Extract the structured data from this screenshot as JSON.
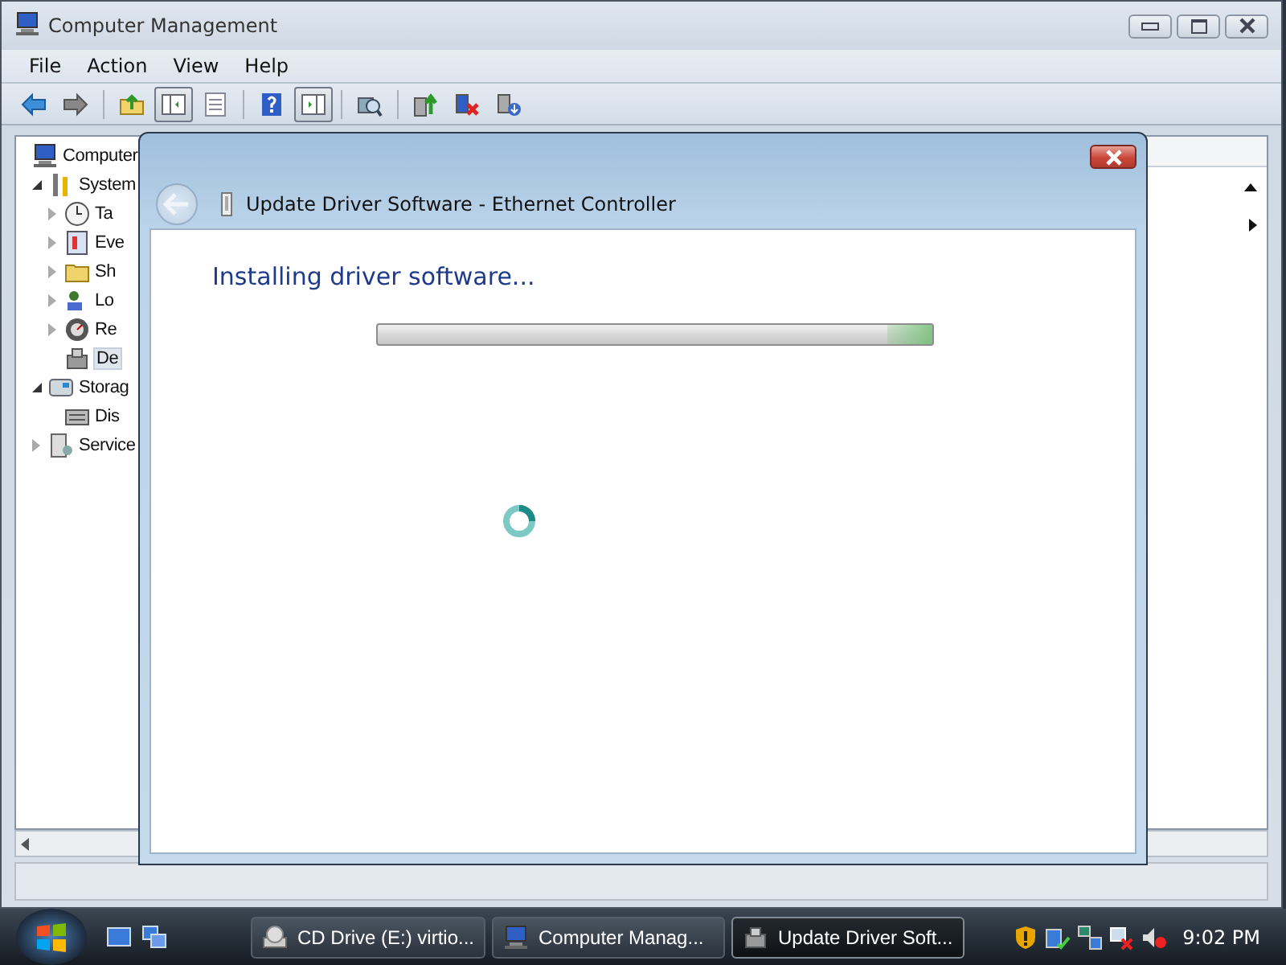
{
  "window": {
    "title": "Computer Management"
  },
  "menu": [
    "File",
    "Action",
    "View",
    "Help"
  ],
  "toolbar": [
    {
      "kind": "back",
      "pressed": false
    },
    {
      "kind": "forward",
      "pressed": false
    },
    {
      "kind": "sep"
    },
    {
      "kind": "up",
      "pressed": false
    },
    {
      "kind": "tree",
      "pressed": true
    },
    {
      "kind": "list",
      "pressed": false
    },
    {
      "kind": "sep"
    },
    {
      "kind": "help",
      "pressed": false
    },
    {
      "kind": "pane",
      "pressed": true
    },
    {
      "kind": "sep"
    },
    {
      "kind": "scan",
      "pressed": false
    },
    {
      "kind": "sep"
    },
    {
      "kind": "update",
      "pressed": false
    },
    {
      "kind": "uninstall",
      "pressed": false
    },
    {
      "kind": "disable",
      "pressed": false
    }
  ],
  "tree": [
    {
      "label": "Computer",
      "children": [
        {
          "label": "System",
          "expanded": true,
          "children": [
            {
              "label": "Ta",
              "expanded": false
            },
            {
              "label": "Eve",
              "expanded": false
            },
            {
              "label": "Sh",
              "expanded": false
            },
            {
              "label": "Lo",
              "expanded": false
            },
            {
              "label": "Re",
              "expanded": false
            },
            {
              "label": "De",
              "selected": true
            }
          ]
        },
        {
          "label": "Storag",
          "expanded": true,
          "children": [
            {
              "label": "Dis"
            }
          ]
        },
        {
          "label": "Service",
          "expanded": false
        }
      ]
    }
  ],
  "dialog": {
    "title": "Update Driver Software - Ethernet Controller",
    "back_disabled": true,
    "heading": "Installing driver software...",
    "progress": {
      "level": 0.08
    }
  },
  "taskbar": {
    "buttons": [
      {
        "label": "CD Drive (E:) virtio...",
        "selected": false
      },
      {
        "label": "Computer Manag...",
        "selected": false
      },
      {
        "label": "Update Driver Soft...",
        "selected": true
      }
    ],
    "clock": "9:02 PM"
  }
}
